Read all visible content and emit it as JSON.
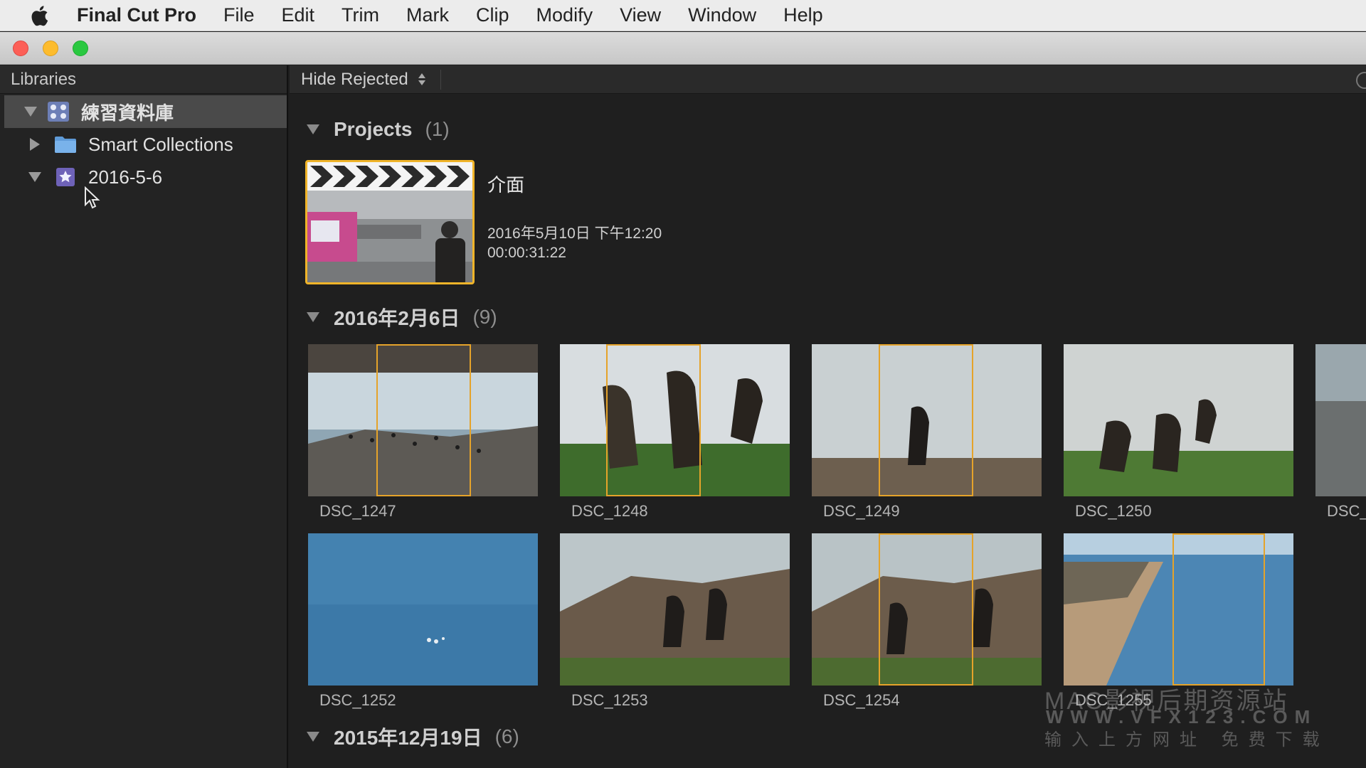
{
  "menubar": {
    "apple_icon": "apple-logo-icon",
    "items": [
      "Final Cut Pro",
      "File",
      "Edit",
      "Trim",
      "Mark",
      "Clip",
      "Modify",
      "View",
      "Window",
      "Help"
    ]
  },
  "sidebar": {
    "header": "Libraries",
    "items": [
      {
        "label": "練習資料庫",
        "icon": "library-icon",
        "expanded": true,
        "selected": true
      },
      {
        "label": "Smart Collections",
        "icon": "folder-icon",
        "expanded": false,
        "selected": false
      },
      {
        "label": "2016-5-6",
        "icon": "event-star-icon",
        "expanded": true,
        "selected": false
      }
    ]
  },
  "browser": {
    "filter_label": "Hide Rejected",
    "sections": [
      {
        "title": "Projects",
        "count": "(1)"
      },
      {
        "title": "2016年2月6日",
        "count": "(9)"
      },
      {
        "title": "2015年12月19日",
        "count": "(6)"
      }
    ],
    "project": {
      "name": "介面",
      "date": "2016年5月10日 下午12:20",
      "duration": "00:00:31:22"
    },
    "clips": [
      {
        "name": "DSC_1247"
      },
      {
        "name": "DSC_1248"
      },
      {
        "name": "DSC_1249"
      },
      {
        "name": "DSC_1250"
      },
      {
        "name": "DSC_"
      },
      {
        "name": "DSC_1252"
      },
      {
        "name": "DSC_1253"
      },
      {
        "name": "DSC_1254"
      },
      {
        "name": "DSC_1255"
      }
    ]
  },
  "watermark": {
    "line1": "MAC影视后期资源站",
    "line2": "WWW.VFX123.COM",
    "line3": "输入上方网址 免费下载"
  },
  "colors": {
    "selection_yellow": "#f0b429",
    "range_orange": "#e5a32a"
  }
}
